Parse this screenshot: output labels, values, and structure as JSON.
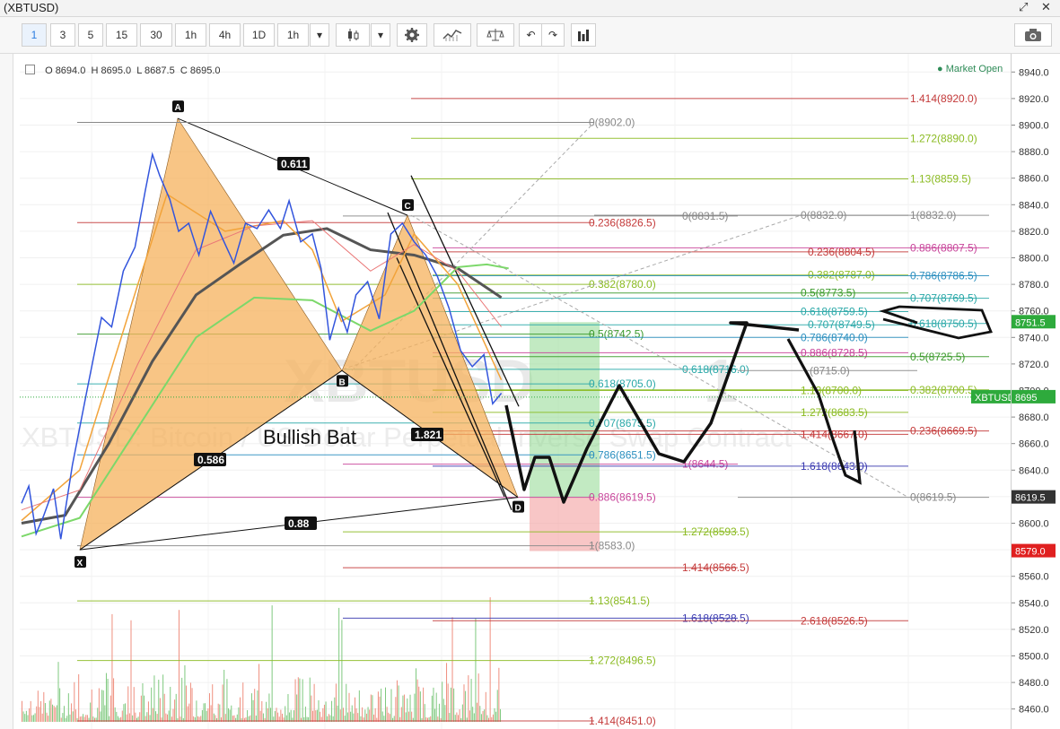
{
  "window": {
    "title": "(XBTUSD)"
  },
  "toolbar": {
    "intervals": [
      "1",
      "3",
      "5",
      "15",
      "30",
      "1h",
      "4h",
      "1D"
    ],
    "active_interval": "1",
    "dropdown_value": "1h",
    "icons": [
      "candlestick-icon",
      "dropdown-icon",
      "gear-icon",
      "indicator-icon",
      "compare-scale-icon",
      "undo-icon",
      "redo-icon",
      "bars-icon",
      "camera-icon"
    ]
  },
  "legend": {
    "o_label": "O",
    "o": "8694.0",
    "h_label": "H",
    "h": "8695.0",
    "l_label": "L",
    "l": "8687.5",
    "c_label": "C",
    "c": "8695.0"
  },
  "market_status": "● Market Open",
  "watermark": {
    "symbol": "XBTUSD",
    "interval": "1",
    "description": "XBTUSD: Bitcoin / US Dollar Perpetual Inverse Swap Contract"
  },
  "pattern": {
    "name": "Bullish Bat",
    "points": [
      "X",
      "A",
      "B",
      "C",
      "D"
    ],
    "ratios": [
      "0.611",
      "0.586",
      "1.821",
      "0.88"
    ]
  },
  "axis_badges": [
    {
      "text": "8751.5",
      "color": "#2eaa3c"
    },
    {
      "text": "XBTUSD",
      "color": "#2eaa3c"
    },
    {
      "text": "8695",
      "color": "#2eaa3c"
    },
    {
      "text": "8619.5",
      "color": "#333333"
    },
    {
      "text": "8579.0",
      "color": "#e02020"
    }
  ],
  "chart_data": {
    "type": "line",
    "symbol": "XBTUSD",
    "interval": "1",
    "ylim": [
      8451,
      8950
    ],
    "y_ticks": [
      "8940.0",
      "8920.0",
      "8900.0",
      "8880.0",
      "8860.0",
      "8840.0",
      "8820.0",
      "8800.0",
      "8780.0",
      "8760.0",
      "8740.0",
      "8720.0",
      "8700.0",
      "8680.0",
      "8660.0",
      "8640.0",
      "8620.0",
      "8600.0",
      "8580.0",
      "8560.0",
      "8540.0",
      "8520.0",
      "8500.0",
      "8480.0",
      "8460.0"
    ],
    "price_series": [
      {
        "i": 0,
        "p": 8615
      },
      {
        "i": 5,
        "p": 8628
      },
      {
        "i": 10,
        "p": 8592
      },
      {
        "i": 15,
        "p": 8605
      },
      {
        "i": 22,
        "p": 8626
      },
      {
        "i": 27,
        "p": 8588
      },
      {
        "i": 35,
        "p": 8644
      },
      {
        "i": 45,
        "p": 8700
      },
      {
        "i": 55,
        "p": 8755
      },
      {
        "i": 62,
        "p": 8748
      },
      {
        "i": 70,
        "p": 8790
      },
      {
        "i": 78,
        "p": 8808
      },
      {
        "i": 85,
        "p": 8850
      },
      {
        "i": 90,
        "p": 8878
      },
      {
        "i": 95,
        "p": 8862
      },
      {
        "i": 102,
        "p": 8844
      },
      {
        "i": 108,
        "p": 8820
      },
      {
        "i": 115,
        "p": 8826
      },
      {
        "i": 122,
        "p": 8802
      },
      {
        "i": 130,
        "p": 8835
      },
      {
        "i": 138,
        "p": 8815
      },
      {
        "i": 146,
        "p": 8796
      },
      {
        "i": 154,
        "p": 8826
      },
      {
        "i": 162,
        "p": 8822
      },
      {
        "i": 170,
        "p": 8836
      },
      {
        "i": 178,
        "p": 8822
      },
      {
        "i": 184,
        "p": 8843
      },
      {
        "i": 192,
        "p": 8812
      },
      {
        "i": 200,
        "p": 8818
      },
      {
        "i": 206,
        "p": 8792
      },
      {
        "i": 212,
        "p": 8738
      },
      {
        "i": 218,
        "p": 8762
      },
      {
        "i": 224,
        "p": 8744
      },
      {
        "i": 230,
        "p": 8772
      },
      {
        "i": 238,
        "p": 8782
      },
      {
        "i": 246,
        "p": 8754
      },
      {
        "i": 254,
        "p": 8818
      },
      {
        "i": 262,
        "p": 8826
      },
      {
        "i": 270,
        "p": 8812
      },
      {
        "i": 278,
        "p": 8802
      },
      {
        "i": 286,
        "p": 8786
      },
      {
        "i": 294,
        "p": 8762
      },
      {
        "i": 302,
        "p": 8730
      },
      {
        "i": 310,
        "p": 8718
      },
      {
        "i": 318,
        "p": 8727
      },
      {
        "i": 324,
        "p": 8690
      },
      {
        "i": 330,
        "p": 8698
      }
    ],
    "ma_series": [
      {
        "name": "MA long",
        "color": "#555555",
        "points": [
          [
            0,
            8600
          ],
          [
            30,
            8606
          ],
          [
            60,
            8660
          ],
          [
            90,
            8722
          ],
          [
            120,
            8772
          ],
          [
            150,
            8795
          ],
          [
            180,
            8817
          ],
          [
            210,
            8822
          ],
          [
            240,
            8806
          ],
          [
            270,
            8802
          ],
          [
            300,
            8792
          ],
          [
            330,
            8770
          ]
        ]
      },
      {
        "name": "MA mid",
        "color": "#7cd86a",
        "points": [
          [
            0,
            8590
          ],
          [
            40,
            8604
          ],
          [
            80,
            8672
          ],
          [
            120,
            8740
          ],
          [
            160,
            8770
          ],
          [
            200,
            8768
          ],
          [
            240,
            8745
          ],
          [
            270,
            8760
          ],
          [
            300,
            8793
          ],
          [
            320,
            8795
          ],
          [
            335,
            8792
          ]
        ]
      },
      {
        "name": "MA fast",
        "color": "#f2a33a",
        "points": [
          [
            0,
            8602
          ],
          [
            40,
            8640
          ],
          [
            80,
            8780
          ],
          [
            100,
            8848
          ],
          [
            140,
            8820
          ],
          [
            180,
            8828
          ],
          [
            200,
            8806
          ],
          [
            220,
            8752
          ],
          [
            250,
            8772
          ],
          [
            270,
            8818
          ],
          [
            300,
            8780
          ],
          [
            330,
            8708
          ]
        ]
      },
      {
        "name": "MA red",
        "color": "#ea7777",
        "points": [
          [
            0,
            8610
          ],
          [
            40,
            8625
          ],
          [
            80,
            8720
          ],
          [
            120,
            8806
          ],
          [
            160,
            8824
          ],
          [
            200,
            8828
          ],
          [
            240,
            8790
          ],
          [
            270,
            8810
          ],
          [
            300,
            8790
          ],
          [
            330,
            8748
          ]
        ]
      }
    ],
    "harmonic_points": [
      {
        "label": "X",
        "price": 8580
      },
      {
        "label": "A",
        "price": 8905
      },
      {
        "label": "B",
        "price": 8715
      },
      {
        "label": "C",
        "price": 8832
      },
      {
        "label": "D",
        "price": 8619.5
      }
    ],
    "fib_levels": [
      {
        "label": "1.414(8920.0)",
        "price": 8920.0,
        "color": "#c43a3a"
      },
      {
        "label": "0(8902.0)",
        "price": 8902.0,
        "color": "#888888"
      },
      {
        "label": "1.272(8890.0)",
        "price": 8890.0,
        "color": "#8bbb22"
      },
      {
        "label": "1.13(8859.5)",
        "price": 8859.5,
        "color": "#8bbb22"
      },
      {
        "label": "0(8831.5)",
        "price": 8831.5,
        "color": "#888888"
      },
      {
        "label": "0(8832.0)",
        "price": 8832.0,
        "color": "#888888"
      },
      {
        "label": "1(8832.0)",
        "price": 8832.0,
        "color": "#888888"
      },
      {
        "label": "0.236(8826.5)",
        "price": 8826.5,
        "color": "#c43a3a"
      },
      {
        "label": "0.886(8807.5)",
        "price": 8807.5,
        "color": "#c8449a"
      },
      {
        "label": "0.236(8804.5)",
        "price": 8804.5,
        "color": "#c43a3a"
      },
      {
        "label": "0.382(8787.0)",
        "price": 8787.0,
        "color": "#8bbb22"
      },
      {
        "label": "0.786(8786.5)",
        "price": 8786.5,
        "color": "#2b8fbf"
      },
      {
        "label": "0.382(8780.0)",
        "price": 8780.0,
        "color": "#8bbb22"
      },
      {
        "label": "0.5(8773.5)",
        "price": 8773.5,
        "color": "#3a9a2a"
      },
      {
        "label": "0.707(8769.5)",
        "price": 8769.5,
        "color": "#2aa8a8"
      },
      {
        "label": "0.618(8759.5)",
        "price": 8759.5,
        "color": "#2aa8a8"
      },
      {
        "label": "0.707(8749.5)",
        "price": 8749.5,
        "color": "#2aa8a8"
      },
      {
        "label": "0.618(8750.5)",
        "price": 8750.5,
        "color": "#2aa8a8"
      },
      {
        "label": "0.5(8742.5)",
        "price": 8742.5,
        "color": "#3a9a2a"
      },
      {
        "label": "0.786(8740.0)",
        "price": 8740.0,
        "color": "#2b8fbf"
      },
      {
        "label": "0.886(8728.5)",
        "price": 8728.5,
        "color": "#c8449a"
      },
      {
        "label": "0.5(8725.5)",
        "price": 8725.5,
        "color": "#3a9a2a"
      },
      {
        "label": "0.618(8716.0)",
        "price": 8716.0,
        "color": "#2aa8a8"
      },
      {
        "label": "(8715.0)",
        "price": 8715.0,
        "color": "#888888"
      },
      {
        "label": "0.618(8705.0)",
        "price": 8705.0,
        "color": "#2aa8a8"
      },
      {
        "label": "1.13(8700.0)",
        "price": 8700.0,
        "color": "#8bbb22"
      },
      {
        "label": "0.382(8700.5)",
        "price": 8700.5,
        "color": "#8bbb22"
      },
      {
        "label": "1.272(8683.5)",
        "price": 8683.5,
        "color": "#8bbb22"
      },
      {
        "label": "0.707(8675.5)",
        "price": 8675.5,
        "color": "#2aa8a8"
      },
      {
        "label": "0.236(8669.5)",
        "price": 8669.5,
        "color": "#c43a3a"
      },
      {
        "label": "1.414(8667.0)",
        "price": 8667.0,
        "color": "#c43a3a"
      },
      {
        "label": "0.786(8651.5)",
        "price": 8651.5,
        "color": "#2b8fbf"
      },
      {
        "label": "1(8644.5)",
        "price": 8644.5,
        "color": "#c8449a"
      },
      {
        "label": "1.618(8643.0)",
        "price": 8643.0,
        "color": "#3a3ab0"
      },
      {
        "label": "0(8619.5)",
        "price": 8619.5,
        "color": "#888888"
      },
      {
        "label": "0.886(8619.5)",
        "price": 8619.5,
        "color": "#c8449a"
      },
      {
        "label": "1.272(8593.5)",
        "price": 8593.5,
        "color": "#8bbb22"
      },
      {
        "label": "1(8583.0)",
        "price": 8583.0,
        "color": "#888888"
      },
      {
        "label": "1.414(8566.5)",
        "price": 8566.5,
        "color": "#c43a3a"
      },
      {
        "label": "1.13(8541.5)",
        "price": 8541.5,
        "color": "#8bbb22"
      },
      {
        "label": "1.618(8528.5)",
        "price": 8528.5,
        "color": "#3a3ab0"
      },
      {
        "label": "2.618(8526.5)",
        "price": 8526.5,
        "color": "#c43a3a"
      },
      {
        "label": "1.272(8496.5)",
        "price": 8496.5,
        "color": "#8bbb22"
      },
      {
        "label": "1.414(8451.0)",
        "price": 8451.0,
        "color": "#c43a3a"
      }
    ],
    "position_tool": {
      "entry": 8619.5,
      "target": 8751.5,
      "stop": 8579.0
    },
    "last_price": 8695
  }
}
